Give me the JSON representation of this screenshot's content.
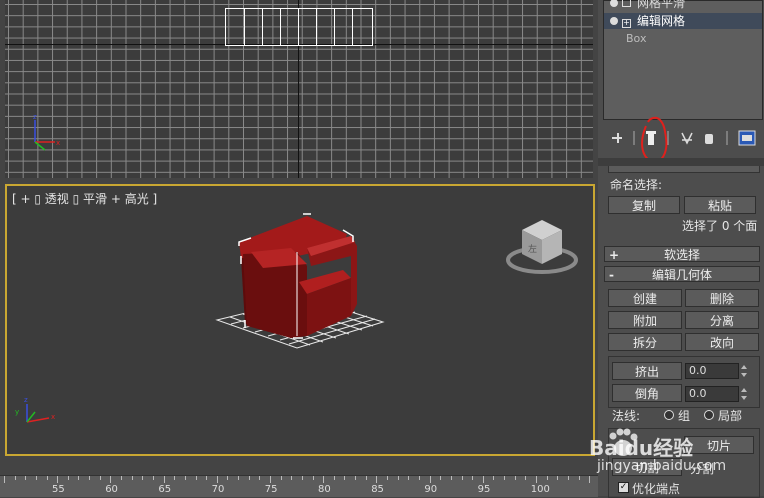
{
  "viewport_persp": {
    "label_parts": [
      "[ +",
      "透视",
      "平滑 + 高光 ]"
    ],
    "label": "[ + ▯ 透视 ▯ 平滑 + 高光 ]",
    "viewcube_text": "左"
  },
  "modifier_stack": {
    "items": [
      {
        "label": "网格平滑"
      },
      {
        "label": "编辑网格"
      },
      {
        "label": "Box"
      }
    ]
  },
  "toolbar_icons": [
    "pin-stack-icon",
    "show-end-result-icon",
    "make-unique-icon",
    "remove-modifier-icon",
    "configure-modifier-sets-icon"
  ],
  "named_selection": {
    "title": "命名选择:",
    "copy": "复制",
    "paste": "粘贴",
    "status": "选择了 0 个面"
  },
  "rollouts": {
    "soft_select": {
      "sign": "+",
      "label": "软选择"
    },
    "edit_geometry": {
      "sign": "-",
      "label": "编辑几何体"
    }
  },
  "edit_geometry": {
    "create": "创建",
    "delete": "删除",
    "attach": "附加",
    "detach": "分离",
    "divide": "拆分",
    "turn": "改向",
    "extrude": "挤出",
    "extrude_value": "0.0",
    "bevel": "倒角",
    "bevel_value": "0.0",
    "normals_label": "法线:",
    "normal_group": "组",
    "normal_local": "局部",
    "slice_label": "切片",
    "cut_label": "切割",
    "split_label": "分割",
    "refine_ends": "优化端点"
  },
  "ruler": {
    "labels": [
      "55",
      "60",
      "65",
      "70",
      "75",
      "80",
      "85",
      "90",
      "95",
      "100"
    ]
  },
  "watermark": {
    "brand": "Baidu经验",
    "url": "jingyan.baidu.com"
  },
  "colors": {
    "viewport_bg": "#3c3c3c",
    "active_border": "#c9a732",
    "chair_red": "#8e1515",
    "annotation_red": "#e0201c"
  }
}
